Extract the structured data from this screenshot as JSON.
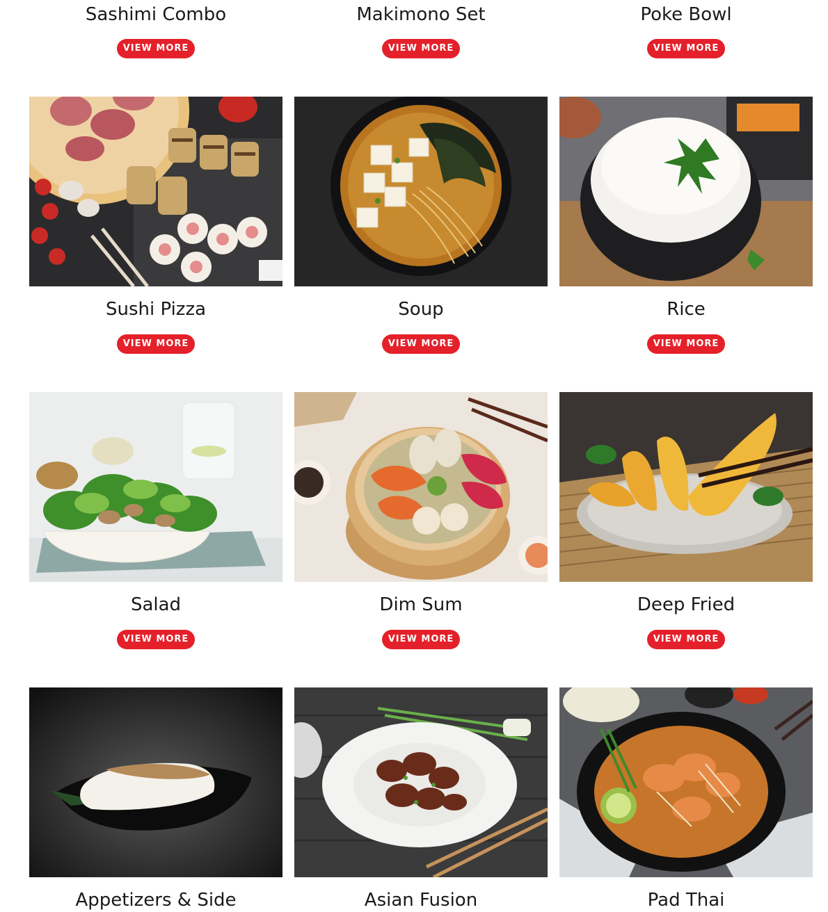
{
  "cards": [
    {
      "title": "Sashimi Combo",
      "button": "VIEW MORE"
    },
    {
      "title": "Makimono Set",
      "button": "VIEW MORE"
    },
    {
      "title": "Poke Bowl",
      "button": "VIEW MORE"
    },
    {
      "title": "Sushi Pizza",
      "button": "VIEW MORE"
    },
    {
      "title": "Soup",
      "button": "VIEW MORE"
    },
    {
      "title": "Rice",
      "button": "VIEW MORE"
    },
    {
      "title": "Salad",
      "button": "VIEW MORE"
    },
    {
      "title": "Dim Sum",
      "button": "VIEW MORE"
    },
    {
      "title": "Deep Fried",
      "button": "VIEW MORE"
    },
    {
      "title": "Appetizers & Side",
      "button": ""
    },
    {
      "title": "Asian Fusion",
      "button": ""
    },
    {
      "title": "Pad Thai",
      "button": ""
    }
  ],
  "colors": {
    "button_background": "#e4202a",
    "button_text": "#ffffff",
    "title_text": "#1a1a1a",
    "page_background": "#ffffff"
  }
}
